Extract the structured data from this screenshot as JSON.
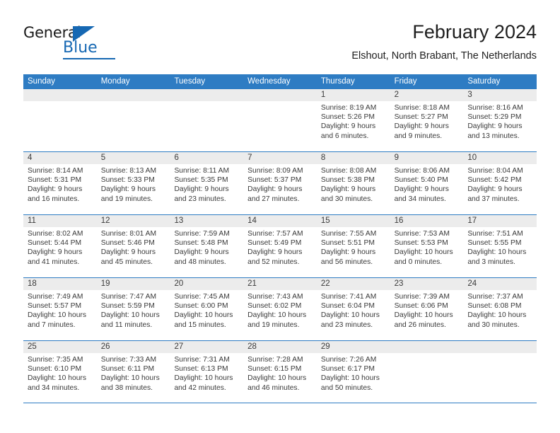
{
  "logo": {
    "word_top": "General",
    "word_bottom": "Blue",
    "triangle_icon": "blue-triangle-icon",
    "brand_color": "#1668b3"
  },
  "header": {
    "title": "February 2024",
    "subtitle": "Elshout, North Brabant, The Netherlands"
  },
  "calendar": {
    "header_color": "#2e7cc3",
    "daynumber_bg": "#ececec",
    "weekdays": [
      "Sunday",
      "Monday",
      "Tuesday",
      "Wednesday",
      "Thursday",
      "Friday",
      "Saturday"
    ],
    "weeks": [
      [
        {
          "day": "",
          "sunrise": "",
          "sunset": "",
          "daylight_line1": "",
          "daylight_line2": ""
        },
        {
          "day": "",
          "sunrise": "",
          "sunset": "",
          "daylight_line1": "",
          "daylight_line2": ""
        },
        {
          "day": "",
          "sunrise": "",
          "sunset": "",
          "daylight_line1": "",
          "daylight_line2": ""
        },
        {
          "day": "",
          "sunrise": "",
          "sunset": "",
          "daylight_line1": "",
          "daylight_line2": ""
        },
        {
          "day": "1",
          "sunrise": "Sunrise: 8:19 AM",
          "sunset": "Sunset: 5:26 PM",
          "daylight_line1": "Daylight: 9 hours",
          "daylight_line2": "and 6 minutes."
        },
        {
          "day": "2",
          "sunrise": "Sunrise: 8:18 AM",
          "sunset": "Sunset: 5:27 PM",
          "daylight_line1": "Daylight: 9 hours",
          "daylight_line2": "and 9 minutes."
        },
        {
          "day": "3",
          "sunrise": "Sunrise: 8:16 AM",
          "sunset": "Sunset: 5:29 PM",
          "daylight_line1": "Daylight: 9 hours",
          "daylight_line2": "and 13 minutes."
        }
      ],
      [
        {
          "day": "4",
          "sunrise": "Sunrise: 8:14 AM",
          "sunset": "Sunset: 5:31 PM",
          "daylight_line1": "Daylight: 9 hours",
          "daylight_line2": "and 16 minutes."
        },
        {
          "day": "5",
          "sunrise": "Sunrise: 8:13 AM",
          "sunset": "Sunset: 5:33 PM",
          "daylight_line1": "Daylight: 9 hours",
          "daylight_line2": "and 19 minutes."
        },
        {
          "day": "6",
          "sunrise": "Sunrise: 8:11 AM",
          "sunset": "Sunset: 5:35 PM",
          "daylight_line1": "Daylight: 9 hours",
          "daylight_line2": "and 23 minutes."
        },
        {
          "day": "7",
          "sunrise": "Sunrise: 8:09 AM",
          "sunset": "Sunset: 5:37 PM",
          "daylight_line1": "Daylight: 9 hours",
          "daylight_line2": "and 27 minutes."
        },
        {
          "day": "8",
          "sunrise": "Sunrise: 8:08 AM",
          "sunset": "Sunset: 5:38 PM",
          "daylight_line1": "Daylight: 9 hours",
          "daylight_line2": "and 30 minutes."
        },
        {
          "day": "9",
          "sunrise": "Sunrise: 8:06 AM",
          "sunset": "Sunset: 5:40 PM",
          "daylight_line1": "Daylight: 9 hours",
          "daylight_line2": "and 34 minutes."
        },
        {
          "day": "10",
          "sunrise": "Sunrise: 8:04 AM",
          "sunset": "Sunset: 5:42 PM",
          "daylight_line1": "Daylight: 9 hours",
          "daylight_line2": "and 37 minutes."
        }
      ],
      [
        {
          "day": "11",
          "sunrise": "Sunrise: 8:02 AM",
          "sunset": "Sunset: 5:44 PM",
          "daylight_line1": "Daylight: 9 hours",
          "daylight_line2": "and 41 minutes."
        },
        {
          "day": "12",
          "sunrise": "Sunrise: 8:01 AM",
          "sunset": "Sunset: 5:46 PM",
          "daylight_line1": "Daylight: 9 hours",
          "daylight_line2": "and 45 minutes."
        },
        {
          "day": "13",
          "sunrise": "Sunrise: 7:59 AM",
          "sunset": "Sunset: 5:48 PM",
          "daylight_line1": "Daylight: 9 hours",
          "daylight_line2": "and 48 minutes."
        },
        {
          "day": "14",
          "sunrise": "Sunrise: 7:57 AM",
          "sunset": "Sunset: 5:49 PM",
          "daylight_line1": "Daylight: 9 hours",
          "daylight_line2": "and 52 minutes."
        },
        {
          "day": "15",
          "sunrise": "Sunrise: 7:55 AM",
          "sunset": "Sunset: 5:51 PM",
          "daylight_line1": "Daylight: 9 hours",
          "daylight_line2": "and 56 minutes."
        },
        {
          "day": "16",
          "sunrise": "Sunrise: 7:53 AM",
          "sunset": "Sunset: 5:53 PM",
          "daylight_line1": "Daylight: 10 hours",
          "daylight_line2": "and 0 minutes."
        },
        {
          "day": "17",
          "sunrise": "Sunrise: 7:51 AM",
          "sunset": "Sunset: 5:55 PM",
          "daylight_line1": "Daylight: 10 hours",
          "daylight_line2": "and 3 minutes."
        }
      ],
      [
        {
          "day": "18",
          "sunrise": "Sunrise: 7:49 AM",
          "sunset": "Sunset: 5:57 PM",
          "daylight_line1": "Daylight: 10 hours",
          "daylight_line2": "and 7 minutes."
        },
        {
          "day": "19",
          "sunrise": "Sunrise: 7:47 AM",
          "sunset": "Sunset: 5:59 PM",
          "daylight_line1": "Daylight: 10 hours",
          "daylight_line2": "and 11 minutes."
        },
        {
          "day": "20",
          "sunrise": "Sunrise: 7:45 AM",
          "sunset": "Sunset: 6:00 PM",
          "daylight_line1": "Daylight: 10 hours",
          "daylight_line2": "and 15 minutes."
        },
        {
          "day": "21",
          "sunrise": "Sunrise: 7:43 AM",
          "sunset": "Sunset: 6:02 PM",
          "daylight_line1": "Daylight: 10 hours",
          "daylight_line2": "and 19 minutes."
        },
        {
          "day": "22",
          "sunrise": "Sunrise: 7:41 AM",
          "sunset": "Sunset: 6:04 PM",
          "daylight_line1": "Daylight: 10 hours",
          "daylight_line2": "and 23 minutes."
        },
        {
          "day": "23",
          "sunrise": "Sunrise: 7:39 AM",
          "sunset": "Sunset: 6:06 PM",
          "daylight_line1": "Daylight: 10 hours",
          "daylight_line2": "and 26 minutes."
        },
        {
          "day": "24",
          "sunrise": "Sunrise: 7:37 AM",
          "sunset": "Sunset: 6:08 PM",
          "daylight_line1": "Daylight: 10 hours",
          "daylight_line2": "and 30 minutes."
        }
      ],
      [
        {
          "day": "25",
          "sunrise": "Sunrise: 7:35 AM",
          "sunset": "Sunset: 6:10 PM",
          "daylight_line1": "Daylight: 10 hours",
          "daylight_line2": "and 34 minutes."
        },
        {
          "day": "26",
          "sunrise": "Sunrise: 7:33 AM",
          "sunset": "Sunset: 6:11 PM",
          "daylight_line1": "Daylight: 10 hours",
          "daylight_line2": "and 38 minutes."
        },
        {
          "day": "27",
          "sunrise": "Sunrise: 7:31 AM",
          "sunset": "Sunset: 6:13 PM",
          "daylight_line1": "Daylight: 10 hours",
          "daylight_line2": "and 42 minutes."
        },
        {
          "day": "28",
          "sunrise": "Sunrise: 7:28 AM",
          "sunset": "Sunset: 6:15 PM",
          "daylight_line1": "Daylight: 10 hours",
          "daylight_line2": "and 46 minutes."
        },
        {
          "day": "29",
          "sunrise": "Sunrise: 7:26 AM",
          "sunset": "Sunset: 6:17 PM",
          "daylight_line1": "Daylight: 10 hours",
          "daylight_line2": "and 50 minutes."
        },
        {
          "day": "",
          "sunrise": "",
          "sunset": "",
          "daylight_line1": "",
          "daylight_line2": ""
        },
        {
          "day": "",
          "sunrise": "",
          "sunset": "",
          "daylight_line1": "",
          "daylight_line2": ""
        }
      ]
    ]
  }
}
